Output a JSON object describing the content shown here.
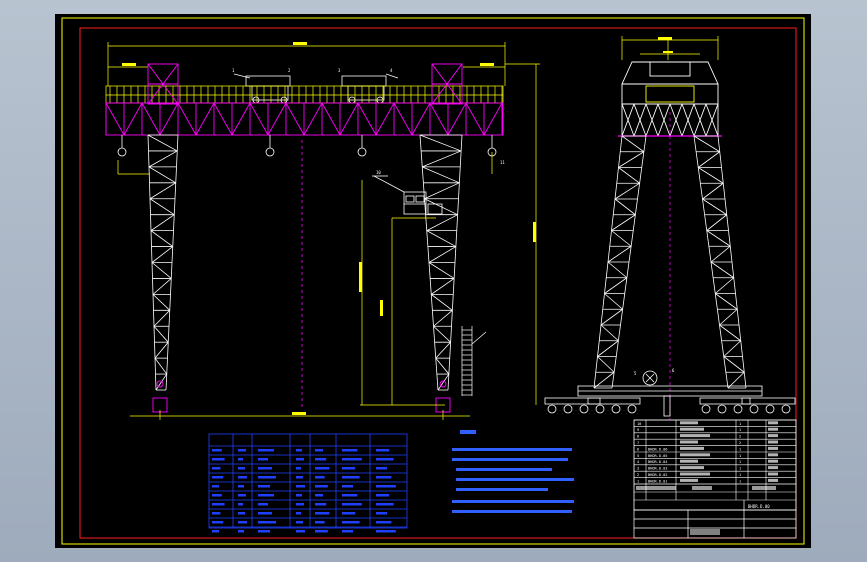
{
  "drawing": {
    "code": "BHDR.D.00",
    "hook_labels": [
      "1",
      "2",
      "3",
      "4",
      "5",
      "6",
      "10",
      "11"
    ]
  },
  "parts_table": {
    "rows": [
      {
        "no": "10",
        "code": "",
        "name": "",
        "qty": "1",
        "remark": ""
      },
      {
        "no": "9",
        "code": "",
        "name": "",
        "qty": "1",
        "remark": ""
      },
      {
        "no": "8",
        "code": "",
        "name": "",
        "qty": "2",
        "remark": ""
      },
      {
        "no": "7",
        "code": "",
        "name": "",
        "qty": "2",
        "remark": ""
      },
      {
        "no": "6",
        "code": "BHDR.D.06",
        "name": "",
        "qty": "1",
        "remark": ""
      },
      {
        "no": "5",
        "code": "BHDR.D.05",
        "name": "",
        "qty": "1",
        "remark": ""
      },
      {
        "no": "4",
        "code": "BHDR.D.04",
        "name": "",
        "qty": "1",
        "remark": ""
      },
      {
        "no": "3",
        "code": "BHDR.D.03",
        "name": "",
        "qty": "1",
        "remark": ""
      },
      {
        "no": "2",
        "code": "BHDR.D.02",
        "name": "",
        "qty": "1",
        "remark": ""
      },
      {
        "no": "1",
        "code": "BHDR.D.01",
        "name": "",
        "qty": "1",
        "remark": ""
      }
    ]
  },
  "colors": {
    "background": "#000000",
    "structure": "#ffffff",
    "dimension": "#ffff00",
    "highlight": "#ff00ff",
    "table": "#0000ff",
    "border": "#ffff00",
    "outer_frame": "#ff0000",
    "leader": "#00ffff"
  }
}
